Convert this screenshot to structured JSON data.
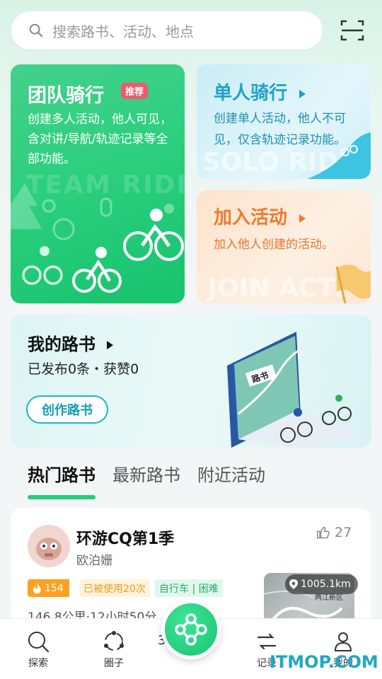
{
  "search": {
    "placeholder": "搜索路书、活动、地点"
  },
  "team_ride": {
    "title": "团队骑行",
    "badge": "推荐",
    "description": "创建多人活动，他人可见，含对讲/导航/轨迹记录等全部功能。",
    "watermark": "TEAM RIDE"
  },
  "solo_ride": {
    "title": "单人骑行",
    "description": "创建单人活动，他人不可见，仅含轨迹记录功能。",
    "watermark": "SOLO RIDE"
  },
  "join_activity": {
    "title": "加入活动",
    "description": "加入他人创建的活动。",
    "watermark": "JOIN ACTI"
  },
  "my_routes": {
    "title": "我的路书",
    "stats": "已发布0条・获赞0",
    "create_label": "创作路书",
    "book_label": "路书"
  },
  "tabs": [
    "热门路书",
    "最新路书",
    "附近活动"
  ],
  "route": {
    "title": "环游CQ第1季",
    "author": "欧泊姗",
    "likes": "27",
    "heat": "154",
    "used": "已被使用20次",
    "type": "自行车 | 困难",
    "metrics": "146.8公里·12小时50分",
    "distance": "1005.1km",
    "map_label": "两江新区"
  },
  "nav": {
    "explore": "探索",
    "circle": "圈子",
    "record": "记录",
    "mine": "我的",
    "center_partial": "3"
  },
  "watermark": "ITMOP.COM",
  "colors": {
    "accent_green": "#1fcf7b",
    "solo_blue": "#1fa3c6",
    "join_orange": "#ee7a2c"
  }
}
